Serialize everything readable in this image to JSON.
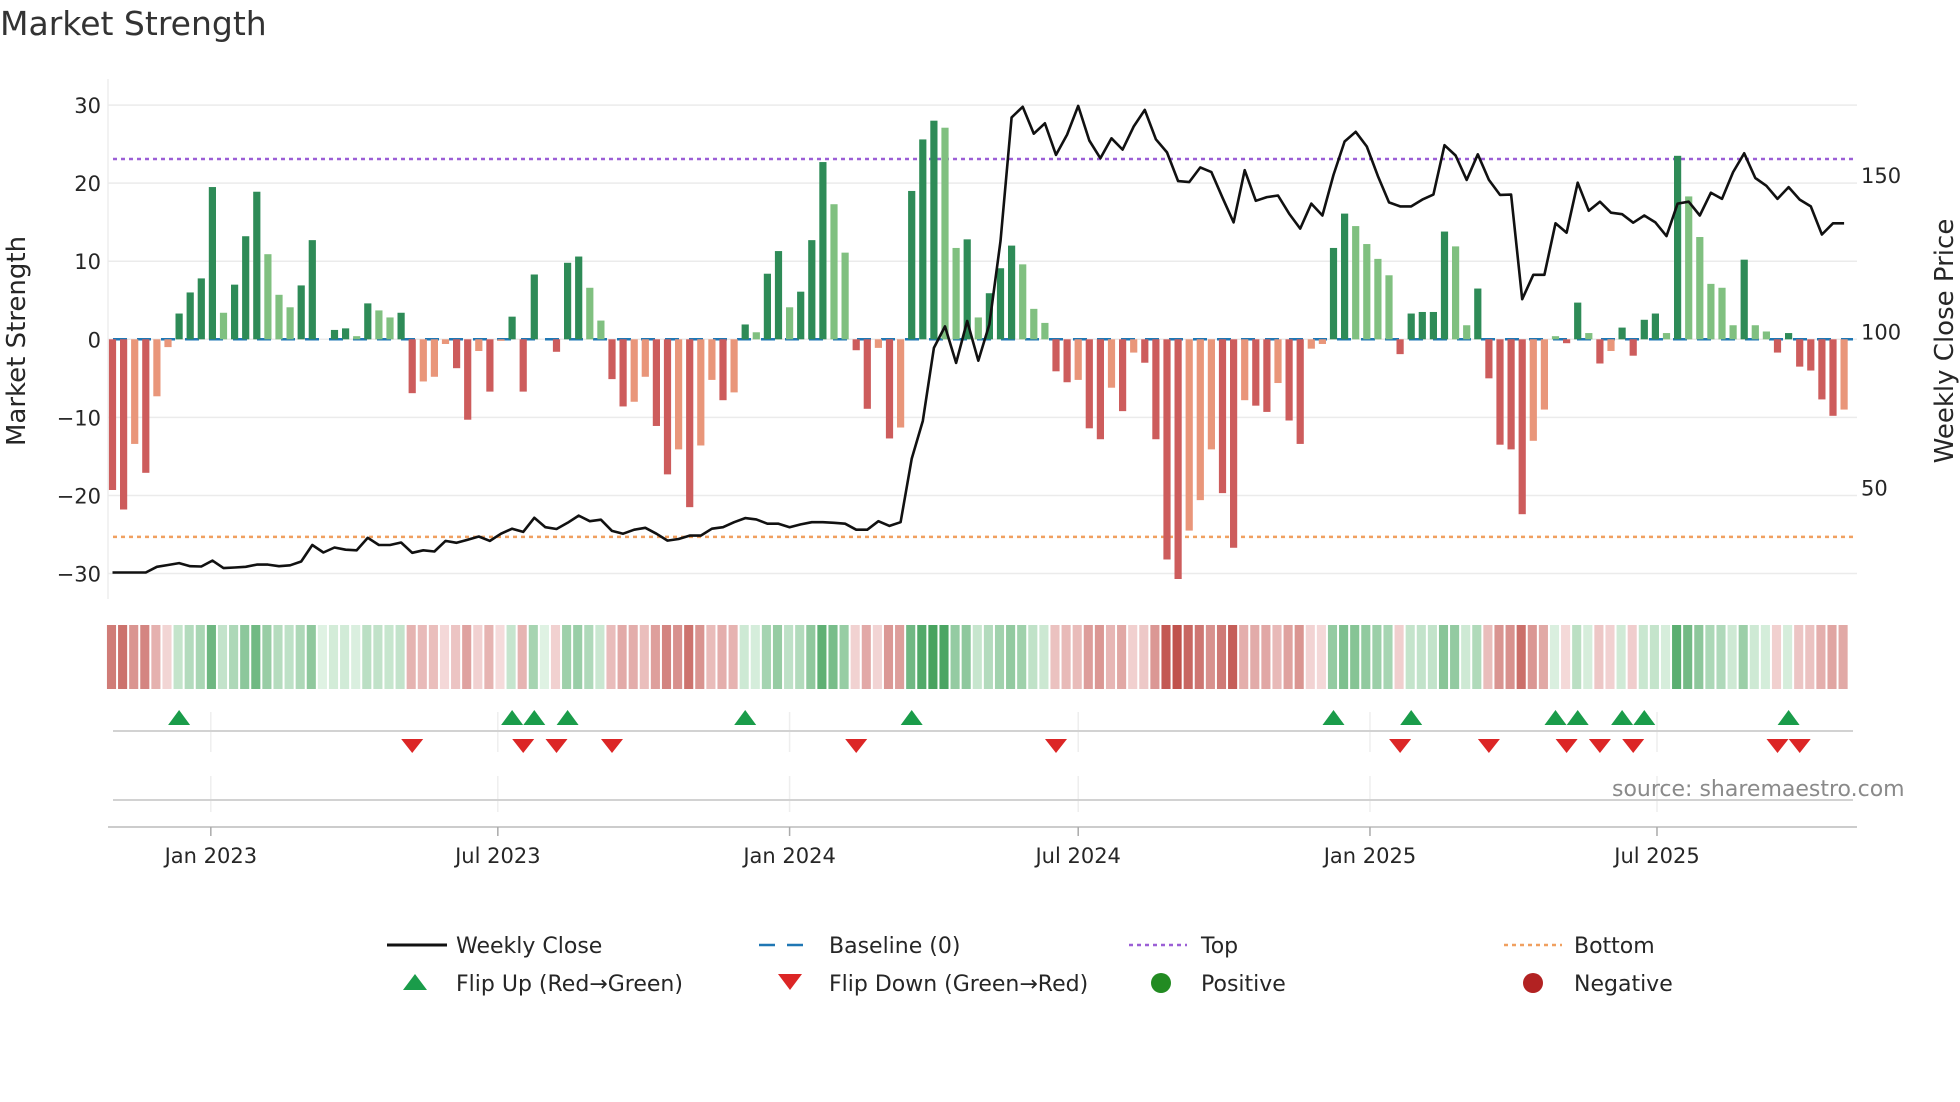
{
  "title": "Market Strength",
  "source": "source: sharemaestro.com",
  "colors": {
    "bar_dark_green": "#2e8b57",
    "bar_light_green": "#80c080",
    "bar_red": "#cd5c5c",
    "bar_salmon": "#e9967a",
    "close_line": "#111111",
    "baseline": "#1f77b4",
    "top": "#9b5fd6",
    "bottom": "#f0a060",
    "flip_up": "#1a9c4a",
    "flip_down": "#dc2626",
    "positive": "#228b22",
    "negative": "#b22222",
    "grid": "#ebebeb"
  },
  "legend": [
    {
      "label": "Weekly Close",
      "kind": "line"
    },
    {
      "label": "Baseline (0)",
      "kind": "dash"
    },
    {
      "label": "Top",
      "kind": "dot-top"
    },
    {
      "label": "Bottom",
      "kind": "dot-bottom"
    },
    {
      "label": "Flip Up (Red→Green)",
      "kind": "tri-up"
    },
    {
      "label": "Flip Down (Green→Red)",
      "kind": "tri-down"
    },
    {
      "label": "Positive",
      "kind": "dot-pos"
    },
    {
      "label": "Negative",
      "kind": "dot-neg"
    }
  ],
  "chart_data": {
    "type": "bar+line",
    "title": "Market Strength",
    "ylabel": "Market Strength",
    "y2label": "Weekly Close Price",
    "ylim": [
      -33.3,
      33.3
    ],
    "y2lim": [
      14.3,
      180.8
    ],
    "yticks": [
      -30,
      -20,
      -10,
      0,
      10,
      20,
      30
    ],
    "yticklabels": [
      "−30",
      "−20",
      "−10",
      "0",
      "10",
      "20",
      "30"
    ],
    "y2ticks": [
      50,
      100,
      150
    ],
    "y2ticklabels": [
      "50",
      "100",
      "150"
    ],
    "frequency": "weekly",
    "start_date": "2022-10-31",
    "xticks": [
      {
        "date": "2023-01-01",
        "label": "Jan 2023"
      },
      {
        "date": "2023-07-01",
        "label": "Jul 2023"
      },
      {
        "date": "2024-01-01",
        "label": "Jan 2024"
      },
      {
        "date": "2024-07-01",
        "label": "Jul 2024"
      },
      {
        "date": "2025-01-01",
        "label": "Jan 2025"
      },
      {
        "date": "2025-07-01",
        "label": "Jul 2025"
      }
    ],
    "top_level": 23.1,
    "bottom_level": -25.3,
    "baseline": 0,
    "strength": [
      -19.3,
      -21.8,
      -13.4,
      -17.1,
      -7.3,
      -1.0,
      3.3,
      6.0,
      7.8,
      19.5,
      3.4,
      7.0,
      13.2,
      18.9,
      10.9,
      5.7,
      4.1,
      6.9,
      12.7,
      0,
      1.2,
      1.4,
      0.4,
      4.6,
      3.7,
      2.8,
      3.4,
      -6.9,
      -5.4,
      -4.8,
      -0.6,
      -3.7,
      -10.3,
      -1.5,
      -6.7,
      -0.2,
      2.9,
      -6.7,
      8.3,
      0,
      -1.6,
      9.8,
      10.6,
      6.6,
      2.4,
      -5.1,
      -8.6,
      -8.0,
      -4.8,
      -11.1,
      -17.3,
      -14.1,
      -21.5,
      -13.6,
      -5.2,
      -7.8,
      -6.8,
      1.9,
      0.9,
      8.4,
      11.3,
      4.1,
      6.1,
      12.7,
      22.7,
      17.3,
      11.1,
      -1.4,
      -8.9,
      -1.1,
      -12.7,
      -11.3,
      19.0,
      25.6,
      28.0,
      27.1,
      11.7,
      12.8,
      2.8,
      5.9,
      9.1,
      12.0,
      9.6,
      3.9,
      2.1,
      -4.1,
      -5.5,
      -5.2,
      -11.4,
      -12.8,
      -6.2,
      -9.2,
      -1.7,
      -3.0,
      -12.8,
      -28.2,
      -30.7,
      -24.5,
      -20.6,
      -14.1,
      -19.7,
      -26.7,
      -7.8,
      -8.5,
      -9.3,
      -5.6,
      -10.4,
      -13.4,
      -1.2,
      -0.6,
      11.7,
      16.1,
      14.5,
      12.2,
      10.3,
      8.2,
      -1.9,
      3.3,
      3.5,
      3.5,
      13.8,
      11.9,
      1.8,
      6.5,
      -5.0,
      -13.5,
      -14.1,
      -22.4,
      -13.0,
      -9.0,
      0.4,
      -0.5,
      4.7,
      0.8,
      -3.1,
      -1.5,
      1.5,
      -2.1,
      2.5,
      3.3,
      0.8,
      23.5,
      18.3,
      13.1,
      7.1,
      6.6,
      1.8,
      10.2,
      1.8,
      1.0,
      -1.7,
      0.8,
      -3.5,
      -4.0,
      -7.7,
      -9.8,
      -9.0
    ],
    "bar_shade": [
      "R",
      "R",
      "S",
      "R",
      "S",
      "S",
      "D",
      "D",
      "D",
      "D",
      "L",
      "D",
      "D",
      "D",
      "L",
      "L",
      "L",
      "D",
      "D",
      "L",
      "D",
      "D",
      "L",
      "D",
      "L",
      "L",
      "D",
      "R",
      "S",
      "S",
      "S",
      "R",
      "R",
      "S",
      "R",
      "S",
      "D",
      "R",
      "D",
      "D",
      "R",
      "D",
      "D",
      "L",
      "L",
      "R",
      "R",
      "S",
      "S",
      "R",
      "R",
      "S",
      "R",
      "S",
      "S",
      "R",
      "S",
      "D",
      "L",
      "D",
      "D",
      "L",
      "D",
      "D",
      "D",
      "L",
      "L",
      "R",
      "R",
      "S",
      "R",
      "S",
      "D",
      "D",
      "D",
      "L",
      "L",
      "D",
      "L",
      "D",
      "D",
      "D",
      "L",
      "L",
      "L",
      "R",
      "R",
      "S",
      "R",
      "R",
      "S",
      "R",
      "S",
      "R",
      "R",
      "R",
      "R",
      "S",
      "S",
      "S",
      "R",
      "R",
      "S",
      "R",
      "R",
      "S",
      "R",
      "R",
      "S",
      "S",
      "D",
      "D",
      "L",
      "L",
      "L",
      "L",
      "R",
      "D",
      "D",
      "D",
      "D",
      "L",
      "L",
      "D",
      "R",
      "R",
      "R",
      "R",
      "S",
      "S",
      "L",
      "R",
      "D",
      "L",
      "R",
      "S",
      "D",
      "R",
      "D",
      "D",
      "L",
      "D",
      "L",
      "L",
      "L",
      "L",
      "L",
      "D",
      "L",
      "L",
      "R",
      "D",
      "R",
      "R",
      "R",
      "R",
      "S"
    ],
    "close": [
      22.8,
      22.8,
      22.8,
      22.8,
      24.6,
      25.2,
      25.8,
      24.8,
      24.7,
      26.6,
      24.2,
      24.4,
      24.6,
      25.3,
      25.3,
      24.8,
      25.1,
      26.3,
      31.6,
      29.2,
      30.8,
      30.1,
      29.9,
      33.9,
      31.6,
      31.6,
      32.4,
      29.1,
      29.9,
      29.5,
      32.9,
      32.3,
      33.3,
      34.3,
      32.9,
      35.2,
      36.8,
      35.8,
      40.3,
      37.3,
      36.7,
      38.7,
      41.0,
      39.2,
      39.7,
      36.1,
      35.2,
      36.5,
      37.1,
      35.2,
      33.0,
      33.5,
      34.6,
      34.6,
      36.8,
      37.3,
      38.9,
      40.2,
      39.8,
      38.4,
      38.4,
      37.3,
      38.2,
      38.9,
      38.9,
      38.7,
      38.4,
      36.5,
      36.5,
      39.2,
      37.7,
      38.9,
      59.2,
      71.3,
      94.7,
      101.6,
      89.9,
      103.3,
      90.6,
      102.3,
      128.9,
      168.5,
      171.9,
      163.3,
      166.6,
      156.5,
      163.0,
      172.2,
      161.1,
      155.4,
      161.8,
      158.2,
      165.6,
      170.9,
      161.5,
      157.3,
      148.1,
      147.8,
      152.5,
      151.0,
      142.8,
      134.9,
      151.6,
      141.8,
      143.0,
      143.5,
      137.7,
      132.9,
      140.9,
      137.1,
      150.1,
      160.8,
      163.9,
      159.2,
      149.7,
      141.3,
      140.0,
      140.0,
      142.2,
      143.8,
      159.6,
      156.3,
      148.5,
      156.7,
      148.5,
      143.7,
      143.8,
      110.3,
      118.1,
      118.1,
      134.6,
      131.6,
      147.6,
      138.6,
      141.5,
      138.0,
      137.5,
      134.8,
      137.1,
      134.9,
      130.5,
      140.9,
      141.5,
      137.1,
      144.4,
      142.4,
      151.0,
      157.0,
      149.1,
      146.6,
      142.4,
      146.2,
      142.2,
      140.0,
      131.0,
      134.6,
      134.6
    ],
    "flip_up_weeks": [
      6,
      36,
      38,
      41,
      57,
      72,
      110,
      117,
      130,
      132,
      136,
      138,
      151
    ],
    "flip_down_weeks": [
      27,
      37,
      40,
      45,
      67,
      85,
      116,
      124,
      131,
      134,
      137,
      150,
      152
    ],
    "grid": true,
    "legend_position": "bottom"
  }
}
